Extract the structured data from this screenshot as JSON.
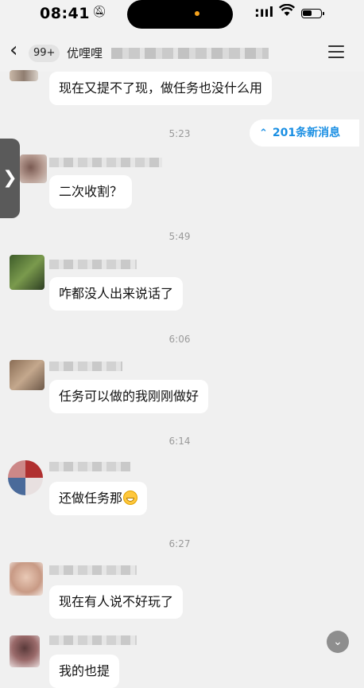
{
  "status_bar": {
    "time": "08:41"
  },
  "nav": {
    "back_icon": "chevron-left",
    "unread_badge": "99+",
    "title": "优哩哩",
    "menu_icon": "hamburger"
  },
  "new_messages": {
    "label": "201条新消息"
  },
  "messages": [
    {
      "text": "现在又提不了现，做任务也没什么用"
    },
    {
      "time": "5:23",
      "text": "二次收割？"
    },
    {
      "time": "5:49",
      "text": "咋都没人出来说话了"
    },
    {
      "time": "6:06",
      "text": "任务可以做的我刚刚做好"
    },
    {
      "time": "6:14",
      "text": "还做任务那"
    },
    {
      "time": "6:27",
      "text": "现在有人说不好玩了"
    },
    {
      "text": "我的也提"
    }
  ],
  "colors": {
    "accent": "#1a8fe3",
    "background": "#f0f0f0",
    "bubble": "#ffffff"
  }
}
